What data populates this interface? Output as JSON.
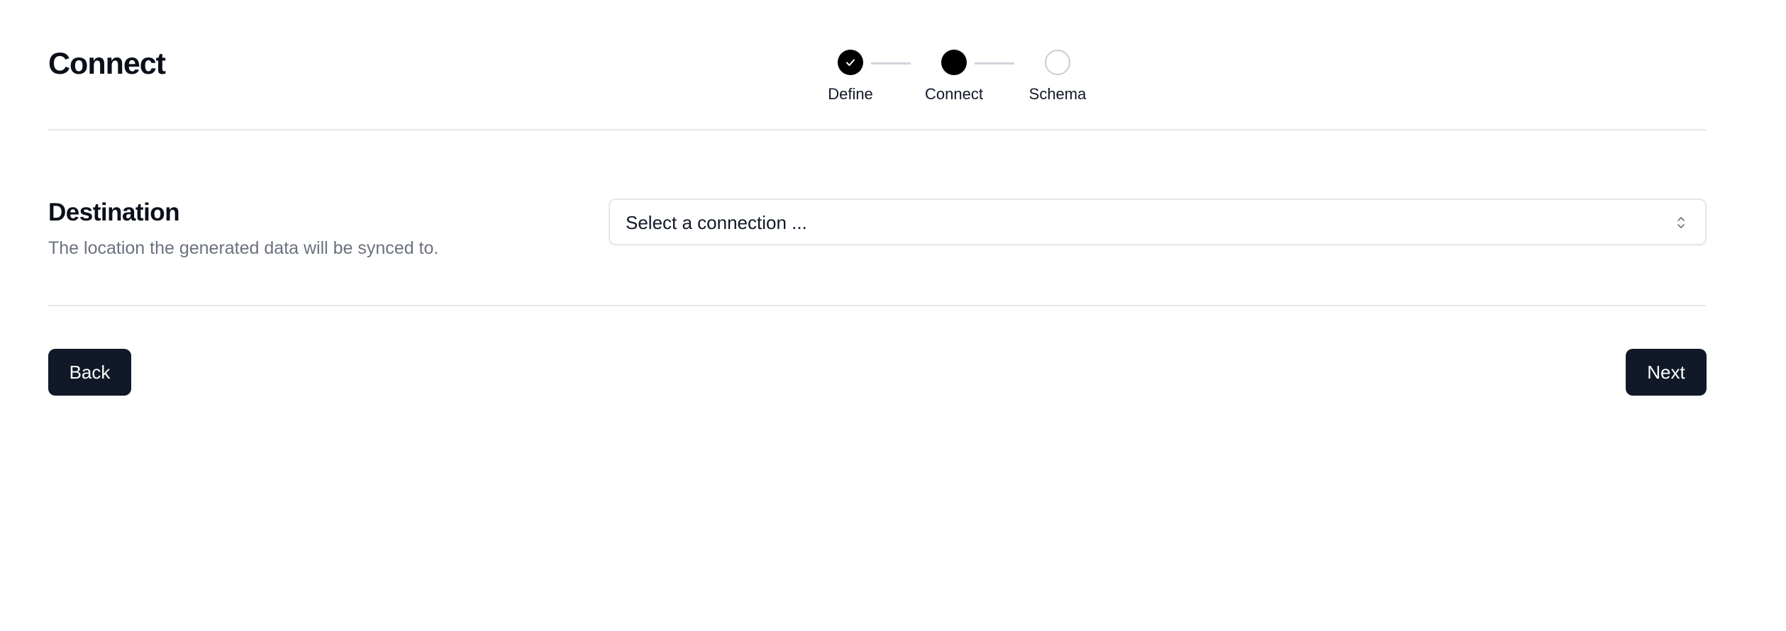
{
  "header": {
    "title": "Connect"
  },
  "stepper": {
    "steps": [
      {
        "label": "Define",
        "state": "complete"
      },
      {
        "label": "Connect",
        "state": "active"
      },
      {
        "label": "Schema",
        "state": "pending"
      }
    ]
  },
  "destination": {
    "title": "Destination",
    "description": "The location the generated data will be synced to.",
    "select": {
      "placeholder": "Select a connection ..."
    }
  },
  "actions": {
    "back_label": "Back",
    "next_label": "Next"
  },
  "icons": {
    "step_complete": "check-icon",
    "select_chevrons": "chevron-up-down-icon"
  },
  "colors": {
    "primary_button": "#111827",
    "step_active": "#000000",
    "step_pending_border": "#c9ccd1",
    "divider": "#e5e7eb",
    "muted_text": "#6b7280"
  }
}
